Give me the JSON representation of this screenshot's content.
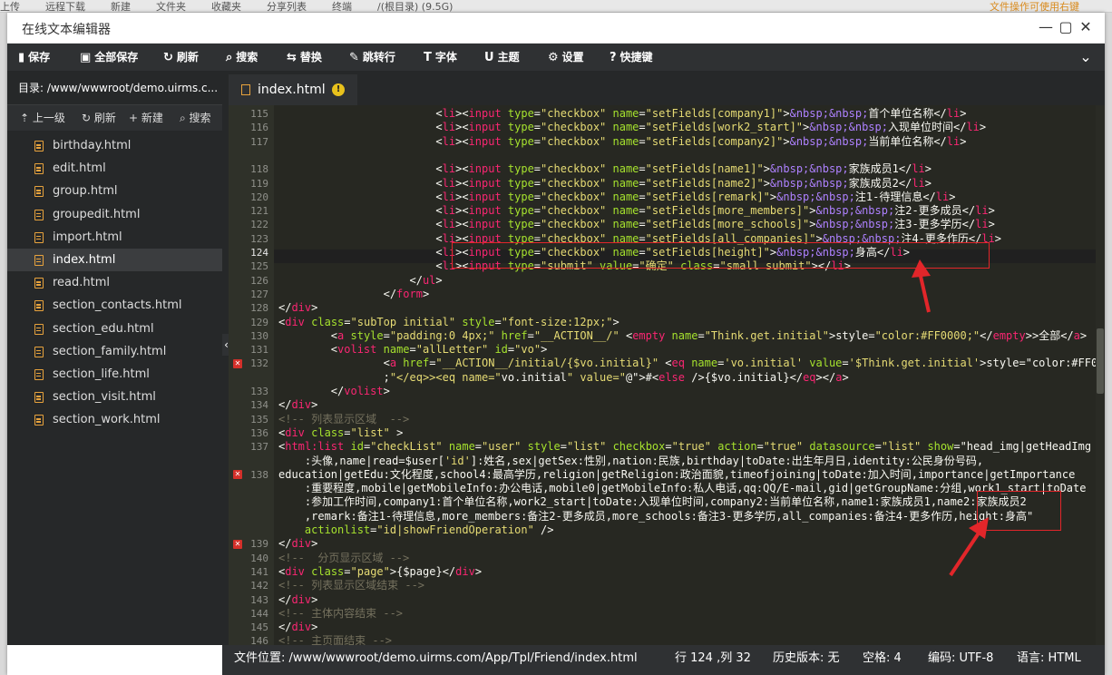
{
  "background_bar": {
    "items": [
      "上传",
      "远程下载",
      "新建",
      "文件夹",
      "收藏夹",
      "分享列表",
      "终端",
      "/(根目录) (9.5G)"
    ],
    "right": "文件操作可使用右键"
  },
  "window": {
    "title": "在线文本编辑器",
    "min": "—",
    "max": "▢",
    "close": "✕"
  },
  "toolbar": {
    "items": [
      {
        "icon": "save-icon",
        "glyph": "▮",
        "label": "保存"
      },
      {
        "icon": "save-all-icon",
        "glyph": "▣",
        "label": "全部保存"
      },
      {
        "icon": "refresh-icon",
        "glyph": "↻",
        "label": "刷新"
      },
      {
        "icon": "search-icon",
        "glyph": "⌕",
        "label": "搜索"
      },
      {
        "icon": "replace-icon",
        "glyph": "⇆",
        "label": "替换"
      },
      {
        "icon": "goto-line-icon",
        "glyph": "✎",
        "label": "跳转行"
      },
      {
        "icon": "font-icon",
        "glyph": "T",
        "label": "字体"
      },
      {
        "icon": "theme-icon",
        "glyph": "U",
        "label": "主题"
      },
      {
        "icon": "settings-icon",
        "glyph": "⚙",
        "label": "设置"
      },
      {
        "icon": "shortcut-icon",
        "glyph": "?",
        "label": "快捷键"
      }
    ],
    "collapse_glyph": "⌄"
  },
  "sidebar": {
    "dir_label": "目录: /www/wwwroot/demo.uirms.c...",
    "ops": [
      {
        "glyph": "⇡",
        "label": "上一级"
      },
      {
        "glyph": "↻",
        "label": "刷新"
      },
      {
        "glyph": "+",
        "label": "新建"
      },
      {
        "glyph": "⌕",
        "label": "搜索"
      }
    ],
    "files": [
      "birthday.html",
      "edit.html",
      "group.html",
      "groupedit.html",
      "import.html",
      "index.html",
      "read.html",
      "section_contacts.html",
      "section_edu.html",
      "section_family.html",
      "section_life.html",
      "section_visit.html",
      "section_work.html"
    ],
    "active_file": "index.html",
    "splitter_glyph": "‹"
  },
  "tab": {
    "name": "index.html",
    "warn": "!"
  },
  "editor": {
    "lines": [
      {
        "n": "115",
        "t": "                        <li><input type=\"checkbox\" name=\"setFields[company1]\">&nbsp;&nbsp;首个单位名称</li>"
      },
      {
        "n": "116",
        "t": "                        <li><input type=\"checkbox\" name=\"setFields[work2_start]\">&nbsp;&nbsp;入现单位时间</li>"
      },
      {
        "n": "117",
        "t": "                        <li><input type=\"checkbox\" name=\"setFields[company2]\">&nbsp;&nbsp;当前单位名称</li>"
      },
      {
        "n": "",
        "t": ""
      },
      {
        "n": "118",
        "t": "                        <li><input type=\"checkbox\" name=\"setFields[name1]\">&nbsp;&nbsp;家族成员1</li>"
      },
      {
        "n": "119",
        "t": "                        <li><input type=\"checkbox\" name=\"setFields[name2]\">&nbsp;&nbsp;家族成员2</li>"
      },
      {
        "n": "120",
        "t": "                        <li><input type=\"checkbox\" name=\"setFields[remark]\">&nbsp;&nbsp;注1-待理信息</li>"
      },
      {
        "n": "121",
        "t": "                        <li><input type=\"checkbox\" name=\"setFields[more_members]\">&nbsp;&nbsp;注2-更多成员</li>"
      },
      {
        "n": "122",
        "t": "                        <li><input type=\"checkbox\" name=\"setFields[more_schools]\">&nbsp;&nbsp;注3-更多学历</li>"
      },
      {
        "n": "123",
        "t": "                        <li><input type=\"checkbox\" name=\"setFields[all_companies]\">&nbsp;&nbsp;注4-更多作历</li>"
      },
      {
        "n": "124",
        "t": "                        <li><input type=\"checkbox\" name=\"setFields[height]\">&nbsp;&nbsp;身高</li>"
      },
      {
        "n": "125",
        "t": "                        <li><input type=\"submit\" value=\"确定\" class=\"small submit\"></li>"
      },
      {
        "n": "126",
        "t": "                    </ul>"
      },
      {
        "n": "127",
        "t": "                </form>"
      },
      {
        "n": "128",
        "t": "</div>"
      },
      {
        "n": "129",
        "t": "<div class=\"subTop initial\" style=\"font-size:12px;\">"
      },
      {
        "n": "130",
        "t": "        <a style=\"padding:0 4px;\" href=\"__ACTION__/\" <empty name=\"Think.get.initial\">style=\"color:#FF0000;\"</empty>>全部</a>"
      },
      {
        "n": "131",
        "t": "        <volist name=\"allLetter\" id=\"vo\">"
      },
      {
        "n": "132",
        "t": "                <a href=\"__ACTION__/initial/{$vo.initial}\" <eq name='vo.initial' value='$Think.get.initial'>style=\"color:#FF0000"
      },
      {
        "n": "",
        "t": "                ;\"</eq>><eq name=\"vo.initial\" value=\"@\">#<else />{$vo.initial}</eq></a>"
      },
      {
        "n": "133",
        "t": "        </volist>"
      },
      {
        "n": "134",
        "t": "</div>"
      },
      {
        "n": "135",
        "t": "<!-- 列表显示区域  -->"
      },
      {
        "n": "136",
        "t": "<div class=\"list\" >"
      },
      {
        "n": "137",
        "t": "<html:list id=\"checkList\" name=\"user\" style=\"list\" checkbox=\"true\" action=\"true\" datasource=\"list\" show=\"head_img|getHeadImg"
      },
      {
        "n": "",
        "t": "    :头像,name|read=$user['id']:姓名,sex|getSex:性别,nation:民族,birthday|toDate:出生年月日,identity:公民身份号码,"
      },
      {
        "n": "138",
        "t": "education|getEdu:文化程度,school4:最高学历,religion|getReligion:政治面貌,timeofjoining|toDate:加入时间,importance|getImportance"
      },
      {
        "n": "",
        "t": "    :重要程度,mobile|getMobileInfo:办公电话,mobile0|getMobileInfo:私人电话,qq:QQ/E-mail,gid|getGroupName:分组,work1_start|toDate"
      },
      {
        "n": "",
        "t": "    :参加工作时间,company1:首个单位名称,work2_start|toDate:入现单位时间,company2:当前单位名称,name1:家族成员1,name2:家族成员2"
      },
      {
        "n": "",
        "t": "    ,remark:备注1-待理信息,more_members:备注2-更多成员,more_schools:备注3-更多学历,all_companies:备注4-更多作历,height:身高\""
      },
      {
        "n": "",
        "t": "    actionlist=\"id|showFriendOperation\" />"
      },
      {
        "n": "139",
        "t": "</div>"
      },
      {
        "n": "140",
        "t": "<!--  分页显示区域 -->"
      },
      {
        "n": "141",
        "t": "<div class=\"page\">{$page}</div>"
      },
      {
        "n": "142",
        "t": "<!-- 列表显示区域结束 -->"
      },
      {
        "n": "143",
        "t": "</div>"
      },
      {
        "n": "144",
        "t": "<!-- 主体内容结束 -->"
      },
      {
        "n": "145",
        "t": "</div>"
      },
      {
        "n": "146",
        "t": "<!-- 主页面结束 -->"
      }
    ],
    "error_lines": [
      "132",
      "138",
      "139"
    ]
  },
  "status": {
    "path": "文件位置: /www/wwwroot/demo.uirms.com/App/Tpl/Friend/index.html",
    "cursor": "行 124 ,列 32",
    "history": "历史版本: 无",
    "indent": "空格: 4",
    "encoding": "编码: UTF-8",
    "language": "语言: HTML"
  },
  "colors": {
    "editor_bg": "#272822",
    "toolbar_bg": "#2f3133",
    "sidebar_bg": "#262829",
    "annotation_red": "#e2262a",
    "file_icon": "#e8a33d"
  }
}
